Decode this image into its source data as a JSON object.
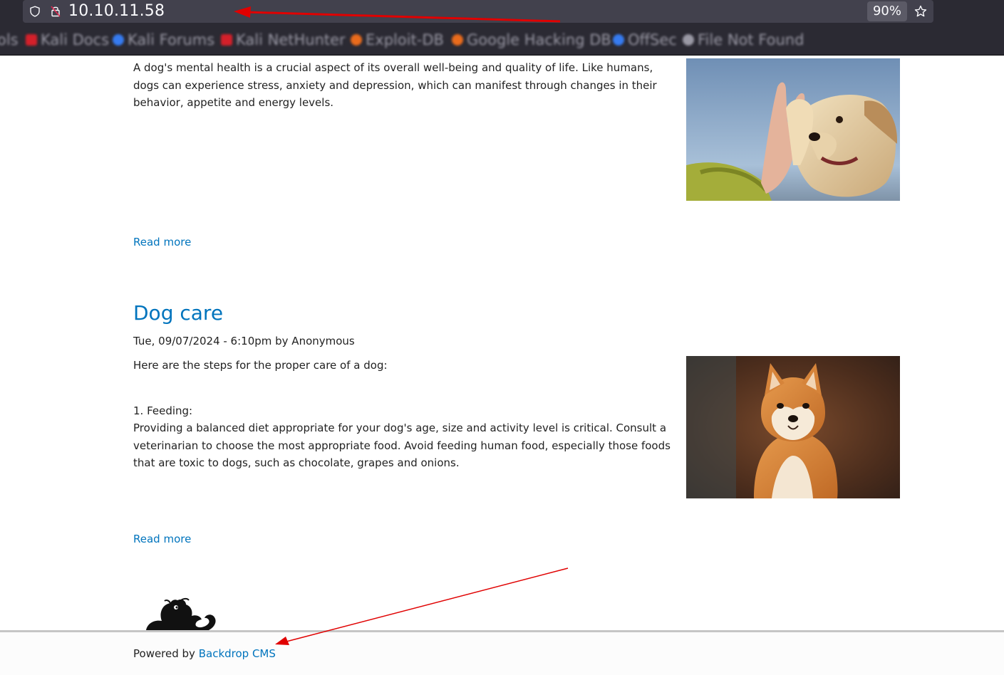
{
  "browser": {
    "url": "10.10.11.58",
    "zoom": "90%",
    "bookmarks": [
      {
        "label": "ols",
        "color": ""
      },
      {
        "label": "Kali Docs",
        "color": "#d4202a"
      },
      {
        "label": "Kali Forums",
        "color": "#367bf0"
      },
      {
        "label": "Kali NetHunter",
        "color": "#d4202a"
      },
      {
        "label": "Exploit-DB",
        "color": "#e96b1c"
      },
      {
        "label": "Google Hacking DB",
        "color": "#e96b1c"
      },
      {
        "label": "OffSec",
        "color": "#367bf0"
      },
      {
        "label": "File Not Found",
        "color": "#9a99a5"
      }
    ]
  },
  "posts": [
    {
      "body": "A dog's mental health is a crucial aspect of its overall well-being and quality of life. Like humans, dogs can experience stress, anxiety and depression, which can manifest through changes in their behavior, appetite and energy levels.",
      "read_more": "Read more",
      "image": "dog-high-five-photo"
    },
    {
      "title": "Dog care",
      "meta": "Tue, 09/07/2024 - 6:10pm by Anonymous",
      "intro": "Here are the steps for the proper care of a dog:",
      "step_heading": "1. Feeding:",
      "step_body": "Providing a balanced diet appropriate for your dog's age, size and activity level is critical. Consult a veterinarian to choose the most appropriate food. Avoid feeding human food, especially those foods that are toxic to dogs, such as chocolate, grapes and onions.",
      "read_more": "Read more",
      "image": "shiba-inu-photo"
    }
  ],
  "footer": {
    "powered_prefix": "Powered by ",
    "powered_link": "Backdrop CMS",
    "logo": "backdrop-drop-logo"
  },
  "annotations": {
    "arrow_color": "#e00000"
  }
}
